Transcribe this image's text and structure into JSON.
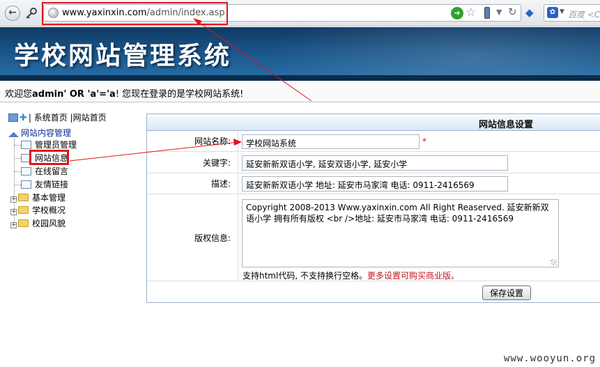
{
  "browser": {
    "url_host": "www.yaxinxin.com",
    "url_path": "/admin/index.asp",
    "search_placeholder": "百度 <C",
    "icons": [
      "back-icon",
      "key-icon",
      "globe-icon",
      "go-icon",
      "star-icon",
      "phone-icon",
      "reload-icon",
      "extension-icon",
      "baidu-paw-icon"
    ]
  },
  "banner": {
    "title": "学校网站管理系统"
  },
  "welcome": {
    "prefix": "欢迎您",
    "user": "admin' OR 'a'='a",
    "suffix": "! 您现在登录的是学校网站系统!"
  },
  "sidebar": {
    "top_links": [
      "系统首页",
      "网站首页"
    ],
    "root": "网站内容管理",
    "items": [
      {
        "label": "管理员管理"
      },
      {
        "label": "网站信息"
      },
      {
        "label": "在线留言"
      },
      {
        "label": "友情链接"
      }
    ],
    "folders": [
      {
        "label": "基本管理"
      },
      {
        "label": "学校概况"
      },
      {
        "label": "校园风貌"
      }
    ]
  },
  "form": {
    "title": "网站信息设置",
    "site_name_label": "网站名称:",
    "site_name_value": "学校网站系统",
    "required_mark": "*",
    "keywords_label": "关键字:",
    "keywords_value": "延安新新双语小学, 延安双语小学, 延安小学",
    "description_label": "描述:",
    "description_value": "延安新新双语小学 地址: 延安市马家湾 电话: 0911-2416569",
    "copyright_label": "版权信息:",
    "copyright_value": "Copyright 2008-2013 Www.yaxinxin.com All Right Reaserved. 延安新新双语小学 拥有所有版权 <br />地址: 延安市马家湾 电话: 0911-2416569",
    "hint": "支持html代码, 不支持换行空格。",
    "upsell": "更多设置可购买商业版。",
    "save_label": "保存设置"
  },
  "watermark": "www.wooyun.org",
  "colors": {
    "annotation_red": "#e2121b",
    "banner_blue": "#1c5a8f"
  }
}
